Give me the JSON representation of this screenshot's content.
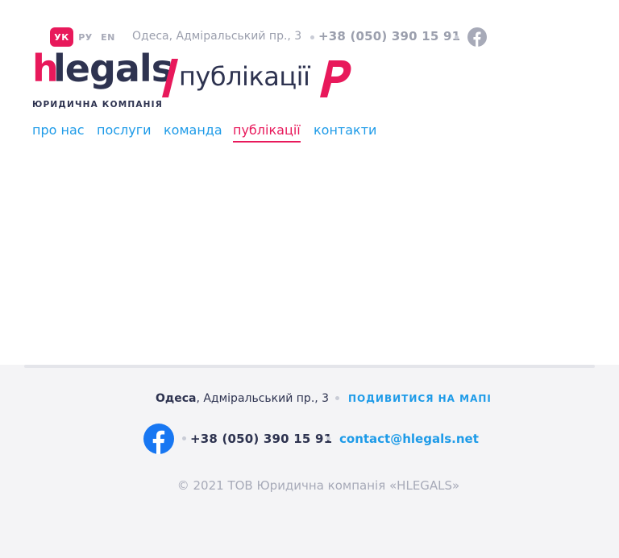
{
  "header": {
    "languages": [
      {
        "code": "УК",
        "active": true
      },
      {
        "code": "РУ",
        "active": false
      },
      {
        "code": "EN",
        "active": false
      }
    ],
    "address": "Одеса, Адміральський пр., 3",
    "phone": "+38 (050) 390 15 91",
    "social_icon": "facebook-icon"
  },
  "logo": {
    "h": "h",
    "word": "legals",
    "subtitle": "ЮРИДИЧНА КОМПАНІЯ",
    "page_title": "публікації"
  },
  "nav": {
    "items": [
      {
        "label": "про нас",
        "active": false
      },
      {
        "label": "послуги",
        "active": false
      },
      {
        "label": "команда",
        "active": false
      },
      {
        "label": "публікації",
        "active": true
      },
      {
        "label": "контакти",
        "active": false
      }
    ]
  },
  "footer": {
    "city": "Одеса",
    "address_rest": ", Адміральський пр., 3",
    "map_link": "ПОДИВИТИСЯ НА МАПІ",
    "phone": "+38 (050) 390 15 91",
    "email": "contact@hlegals.net",
    "copyright": "© 2021 ТОВ Юридична компанія «HLEGALS»"
  },
  "colors": {
    "accent": "#e8195b",
    "link": "#1e9be8",
    "text": "#2e3350",
    "muted": "#9b9fad",
    "footer_bg": "#f4f4f6"
  }
}
